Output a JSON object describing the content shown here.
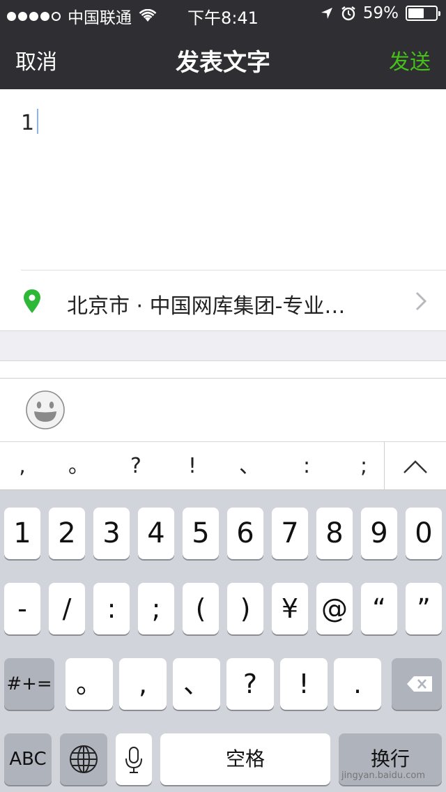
{
  "status_bar": {
    "signal_bars_full": 4,
    "signal_bars_total": 5,
    "carrier": "中国联通",
    "time": "下午8:41",
    "battery_percent_label": "59%",
    "battery_level": 0.59
  },
  "nav": {
    "cancel": "取消",
    "title": "发表文字",
    "send": "发送",
    "send_color": "#45c01a"
  },
  "editor": {
    "text": "1"
  },
  "location": {
    "text": "北京市 · 中国网库集团-专业…",
    "pin_color": "#2fb738"
  },
  "punctuation_bar": {
    "keys": [
      ",",
      "。",
      "?",
      "!",
      "、",
      ":",
      ";"
    ]
  },
  "keyboard": {
    "row1": [
      "1",
      "2",
      "3",
      "4",
      "5",
      "6",
      "7",
      "8",
      "9",
      "0"
    ],
    "row2": [
      "-",
      "/",
      ":",
      ";",
      "(",
      ")",
      "¥",
      "@",
      "“",
      "”"
    ],
    "row3_left": "#+=",
    "row3": [
      "。",
      ",",
      "、",
      "?",
      "!",
      "."
    ],
    "abc": "ABC",
    "space": "空格",
    "return": "换行"
  },
  "watermark": "jingyan.baidu.com"
}
